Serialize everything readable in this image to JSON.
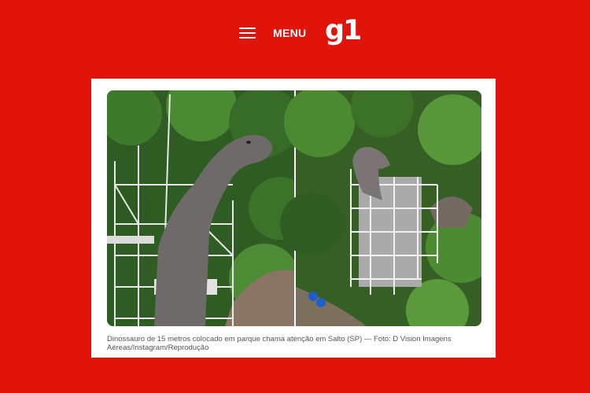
{
  "header": {
    "menu_label": "MENU",
    "logo_text": "g1",
    "icons": [
      "hamburger-menu-icon"
    ]
  },
  "article": {
    "caption": "Dinossauro de 15 metros colocado em parque chama atenção em Salto (SP) — Foto: D Vision Imagens Aéreas/Instagram/Reprodução"
  },
  "colors": {
    "brand_red": "#e0140b",
    "card_bg": "#ffffff",
    "caption_text": "#555555"
  }
}
